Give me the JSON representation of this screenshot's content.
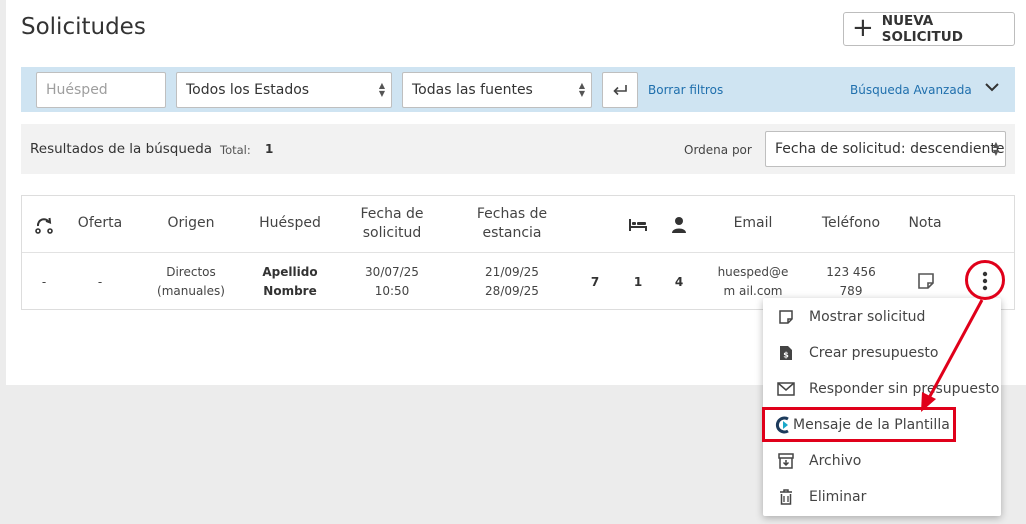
{
  "page": {
    "title": "Solicitudes",
    "new_button_label": "NUEVA SOLICITUD"
  },
  "filters": {
    "guest_placeholder": "Huésped",
    "status_value": "Todos los Estados",
    "source_value": "Todas las fuentes",
    "clear_label": "Borrar filtros",
    "advanced_label": "Búsqueda Avanzada"
  },
  "results": {
    "label": "Resultados de la búsqueda",
    "total_label": "Total:",
    "total_value": "1",
    "sort_label": "Ordena por",
    "sort_value": "Fecha de solicitud: descendiente"
  },
  "table": {
    "headers": {
      "offer": "Oferta",
      "origin": "Origen",
      "guest": "Huésped",
      "request_date": "Fecha de solicitud",
      "stay_dates": "Fechas de estancia",
      "email": "Email",
      "phone": "Teléfono",
      "note": "Nota"
    },
    "header_icons": [
      "sync-icon",
      "moon-icon",
      "bed-icon",
      "person-icon"
    ],
    "row": {
      "status": "-",
      "offer": "-",
      "origin": "Directos (manuales)",
      "guest": "Apellido Nombre",
      "request_date": "30/07/25 10:50",
      "stay_dates": "21/09/25 28/09/25",
      "nights": "7",
      "rooms": "1",
      "persons": "4",
      "email": "huesped@em ail.com",
      "phone": "123 456 789"
    }
  },
  "context_menu": {
    "items": [
      {
        "label": "Mostrar solicitud",
        "icon": "note-icon"
      },
      {
        "label": "Crear presupuesto",
        "icon": "quote-icon"
      },
      {
        "label": "Responder sin presupuesto",
        "icon": "mail-icon"
      },
      {
        "label": "Mensaje de la Plantilla",
        "icon": "template-logo-icon"
      },
      {
        "label": "Archivo",
        "icon": "archive-icon"
      },
      {
        "label": "Eliminar",
        "icon": "trash-icon"
      }
    ],
    "highlighted_item": "Mensaje de la Plantilla"
  },
  "annotation_color": "#e0001a"
}
